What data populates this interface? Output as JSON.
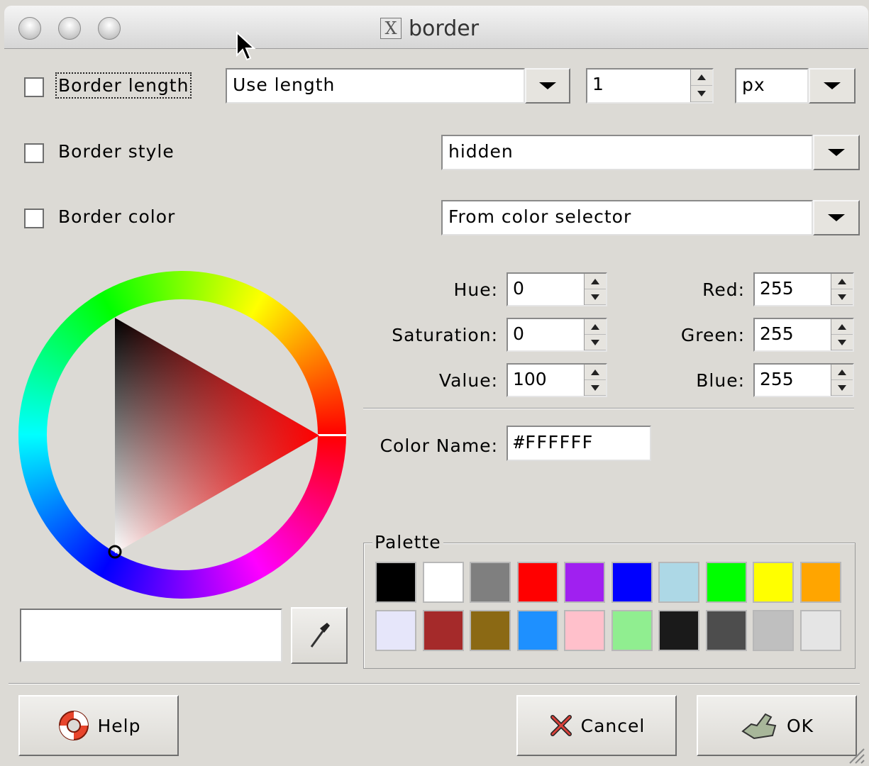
{
  "window": {
    "title": "border",
    "title_icon": "X"
  },
  "rows": {
    "length": {
      "label": "Border length",
      "mode": "Use length",
      "amount": "1",
      "unit": "px"
    },
    "style": {
      "label": "Border style",
      "value": "hidden"
    },
    "color": {
      "label": "Border color",
      "value": "From color selector"
    }
  },
  "hsv": {
    "hue": {
      "label": "Hue:",
      "value": "0"
    },
    "saturation": {
      "label": "Saturation:",
      "value": "0"
    },
    "value": {
      "label": "Value:",
      "value": "100"
    }
  },
  "rgb": {
    "red": {
      "label": "Red:",
      "value": "255"
    },
    "green": {
      "label": "Green:",
      "value": "255"
    },
    "blue": {
      "label": "Blue:",
      "value": "255"
    }
  },
  "color_name": {
    "label": "Color Name:",
    "value": "#FFFFFF"
  },
  "palette": {
    "title": "Palette",
    "colors": [
      "#000000",
      "#ffffff",
      "#7f7f7f",
      "#ff0000",
      "#a020f0",
      "#0000ff",
      "#add8e6",
      "#00ff00",
      "#ffff00",
      "#ffa500",
      "#e6e6fa",
      "#a52a2a",
      "#8b6914",
      "#1e90ff",
      "#ffc0cb",
      "#90ee90",
      "#1a1a1a",
      "#4d4d4d",
      "#bfbfbf",
      "#e5e5e5"
    ]
  },
  "buttons": {
    "help": "Help",
    "cancel": "Cancel",
    "ok": "OK"
  }
}
